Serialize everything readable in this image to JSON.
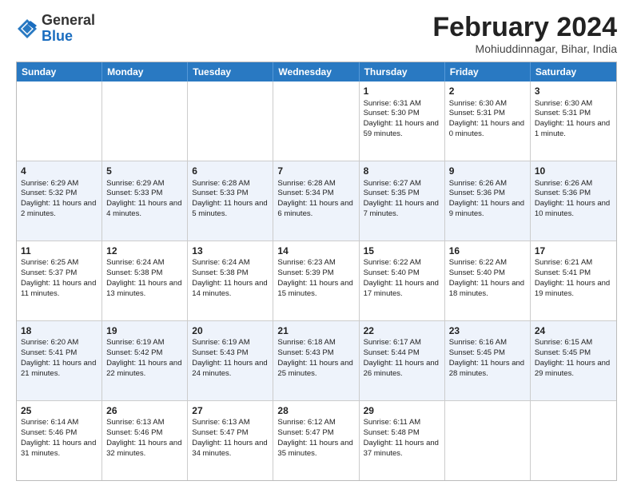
{
  "header": {
    "logo_general": "General",
    "logo_blue": "Blue",
    "month_title": "February 2024",
    "location": "Mohiuddinnagar, Bihar, India"
  },
  "days_of_week": [
    "Sunday",
    "Monday",
    "Tuesday",
    "Wednesday",
    "Thursday",
    "Friday",
    "Saturday"
  ],
  "weeks": [
    [
      {
        "day": "",
        "sunrise": "",
        "sunset": "",
        "daylight": ""
      },
      {
        "day": "",
        "sunrise": "",
        "sunset": "",
        "daylight": ""
      },
      {
        "day": "",
        "sunrise": "",
        "sunset": "",
        "daylight": ""
      },
      {
        "day": "",
        "sunrise": "",
        "sunset": "",
        "daylight": ""
      },
      {
        "day": "1",
        "sunrise": "Sunrise: 6:31 AM",
        "sunset": "Sunset: 5:30 PM",
        "daylight": "Daylight: 11 hours and 59 minutes."
      },
      {
        "day": "2",
        "sunrise": "Sunrise: 6:30 AM",
        "sunset": "Sunset: 5:31 PM",
        "daylight": "Daylight: 11 hours and 0 minutes."
      },
      {
        "day": "3",
        "sunrise": "Sunrise: 6:30 AM",
        "sunset": "Sunset: 5:31 PM",
        "daylight": "Daylight: 11 hours and 1 minute."
      }
    ],
    [
      {
        "day": "4",
        "sunrise": "Sunrise: 6:29 AM",
        "sunset": "Sunset: 5:32 PM",
        "daylight": "Daylight: 11 hours and 2 minutes."
      },
      {
        "day": "5",
        "sunrise": "Sunrise: 6:29 AM",
        "sunset": "Sunset: 5:33 PM",
        "daylight": "Daylight: 11 hours and 4 minutes."
      },
      {
        "day": "6",
        "sunrise": "Sunrise: 6:28 AM",
        "sunset": "Sunset: 5:33 PM",
        "daylight": "Daylight: 11 hours and 5 minutes."
      },
      {
        "day": "7",
        "sunrise": "Sunrise: 6:28 AM",
        "sunset": "Sunset: 5:34 PM",
        "daylight": "Daylight: 11 hours and 6 minutes."
      },
      {
        "day": "8",
        "sunrise": "Sunrise: 6:27 AM",
        "sunset": "Sunset: 5:35 PM",
        "daylight": "Daylight: 11 hours and 7 minutes."
      },
      {
        "day": "9",
        "sunrise": "Sunrise: 6:26 AM",
        "sunset": "Sunset: 5:36 PM",
        "daylight": "Daylight: 11 hours and 9 minutes."
      },
      {
        "day": "10",
        "sunrise": "Sunrise: 6:26 AM",
        "sunset": "Sunset: 5:36 PM",
        "daylight": "Daylight: 11 hours and 10 minutes."
      }
    ],
    [
      {
        "day": "11",
        "sunrise": "Sunrise: 6:25 AM",
        "sunset": "Sunset: 5:37 PM",
        "daylight": "Daylight: 11 hours and 11 minutes."
      },
      {
        "day": "12",
        "sunrise": "Sunrise: 6:24 AM",
        "sunset": "Sunset: 5:38 PM",
        "daylight": "Daylight: 11 hours and 13 minutes."
      },
      {
        "day": "13",
        "sunrise": "Sunrise: 6:24 AM",
        "sunset": "Sunset: 5:38 PM",
        "daylight": "Daylight: 11 hours and 14 minutes."
      },
      {
        "day": "14",
        "sunrise": "Sunrise: 6:23 AM",
        "sunset": "Sunset: 5:39 PM",
        "daylight": "Daylight: 11 hours and 15 minutes."
      },
      {
        "day": "15",
        "sunrise": "Sunrise: 6:22 AM",
        "sunset": "Sunset: 5:40 PM",
        "daylight": "Daylight: 11 hours and 17 minutes."
      },
      {
        "day": "16",
        "sunrise": "Sunrise: 6:22 AM",
        "sunset": "Sunset: 5:40 PM",
        "daylight": "Daylight: 11 hours and 18 minutes."
      },
      {
        "day": "17",
        "sunrise": "Sunrise: 6:21 AM",
        "sunset": "Sunset: 5:41 PM",
        "daylight": "Daylight: 11 hours and 19 minutes."
      }
    ],
    [
      {
        "day": "18",
        "sunrise": "Sunrise: 6:20 AM",
        "sunset": "Sunset: 5:41 PM",
        "daylight": "Daylight: 11 hours and 21 minutes."
      },
      {
        "day": "19",
        "sunrise": "Sunrise: 6:19 AM",
        "sunset": "Sunset: 5:42 PM",
        "daylight": "Daylight: 11 hours and 22 minutes."
      },
      {
        "day": "20",
        "sunrise": "Sunrise: 6:19 AM",
        "sunset": "Sunset: 5:43 PM",
        "daylight": "Daylight: 11 hours and 24 minutes."
      },
      {
        "day": "21",
        "sunrise": "Sunrise: 6:18 AM",
        "sunset": "Sunset: 5:43 PM",
        "daylight": "Daylight: 11 hours and 25 minutes."
      },
      {
        "day": "22",
        "sunrise": "Sunrise: 6:17 AM",
        "sunset": "Sunset: 5:44 PM",
        "daylight": "Daylight: 11 hours and 26 minutes."
      },
      {
        "day": "23",
        "sunrise": "Sunrise: 6:16 AM",
        "sunset": "Sunset: 5:45 PM",
        "daylight": "Daylight: 11 hours and 28 minutes."
      },
      {
        "day": "24",
        "sunrise": "Sunrise: 6:15 AM",
        "sunset": "Sunset: 5:45 PM",
        "daylight": "Daylight: 11 hours and 29 minutes."
      }
    ],
    [
      {
        "day": "25",
        "sunrise": "Sunrise: 6:14 AM",
        "sunset": "Sunset: 5:46 PM",
        "daylight": "Daylight: 11 hours and 31 minutes."
      },
      {
        "day": "26",
        "sunrise": "Sunrise: 6:13 AM",
        "sunset": "Sunset: 5:46 PM",
        "daylight": "Daylight: 11 hours and 32 minutes."
      },
      {
        "day": "27",
        "sunrise": "Sunrise: 6:13 AM",
        "sunset": "Sunset: 5:47 PM",
        "daylight": "Daylight: 11 hours and 34 minutes."
      },
      {
        "day": "28",
        "sunrise": "Sunrise: 6:12 AM",
        "sunset": "Sunset: 5:47 PM",
        "daylight": "Daylight: 11 hours and 35 minutes."
      },
      {
        "day": "29",
        "sunrise": "Sunrise: 6:11 AM",
        "sunset": "Sunset: 5:48 PM",
        "daylight": "Daylight: 11 hours and 37 minutes."
      },
      {
        "day": "",
        "sunrise": "",
        "sunset": "",
        "daylight": ""
      },
      {
        "day": "",
        "sunrise": "",
        "sunset": "",
        "daylight": ""
      }
    ]
  ]
}
